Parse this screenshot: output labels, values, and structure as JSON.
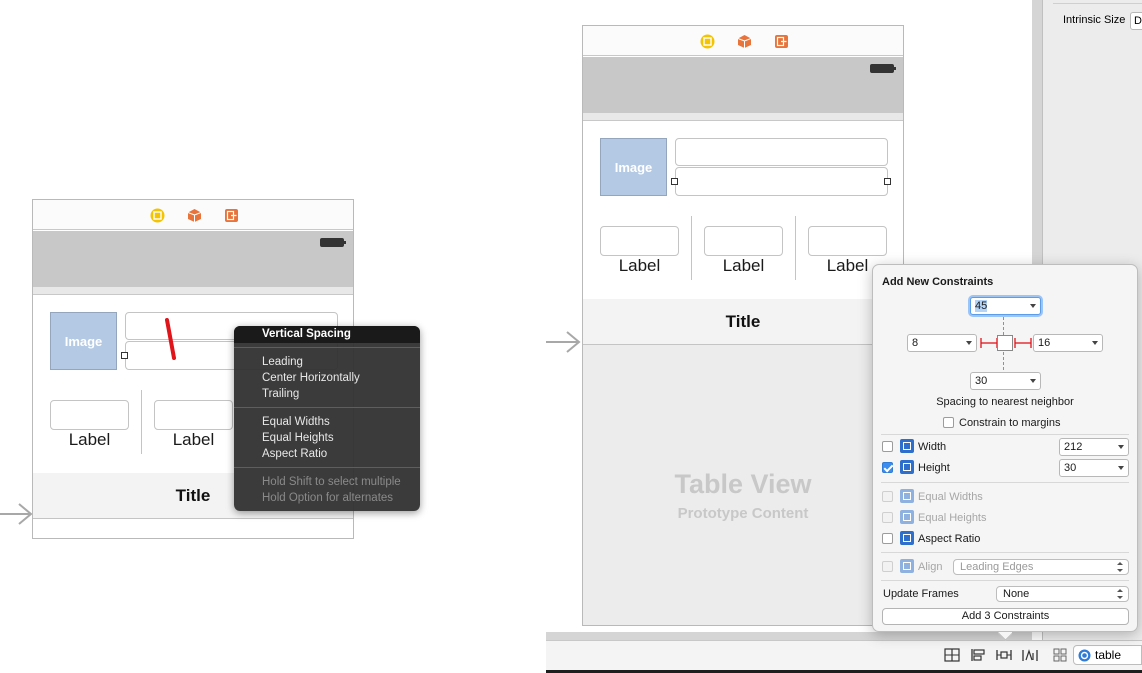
{
  "left_scene": {
    "image_label": "Image",
    "labels": [
      "Label",
      "Label"
    ],
    "title": "Title"
  },
  "context_menu": {
    "items": [
      {
        "label": "Vertical Spacing",
        "highlighted": true
      },
      {
        "label": "Leading"
      },
      {
        "label": "Center Horizontally"
      },
      {
        "label": "Trailing"
      },
      {
        "label": "Equal Widths"
      },
      {
        "label": "Equal Heights"
      },
      {
        "label": "Aspect Ratio"
      }
    ],
    "hints": [
      "Hold Shift to select multiple",
      "Hold Option for alternates"
    ]
  },
  "right_scene": {
    "image_label": "Image",
    "labels": [
      "Label",
      "Label",
      "Label"
    ],
    "title": "Title",
    "table_view_title": "Table View",
    "table_view_subtitle": "Prototype Content"
  },
  "inspector": {
    "intrinsic_size_label": "Intrinsic Size",
    "intrinsic_size_value": "D"
  },
  "constraints_popover": {
    "heading": "Add New Constraints",
    "top_spacing": "45",
    "left_spacing": "8",
    "right_spacing": "16",
    "bottom_spacing": "30",
    "spacing_caption": "Spacing to nearest neighbor",
    "constrain_to_margins": "Constrain to margins",
    "width_label": "Width",
    "width_value": "212",
    "height_label": "Height",
    "height_value": "30",
    "equal_widths": "Equal Widths",
    "equal_heights": "Equal Heights",
    "aspect_ratio": "Aspect Ratio",
    "align_label": "Align",
    "align_value": "Leading Edges",
    "update_frames_label": "Update Frames",
    "update_frames_value": "None",
    "add_button": "Add 3 Constraints"
  },
  "bottom_bar": {
    "filter_value": "table"
  },
  "colors": {
    "accent": "#3b8ef0",
    "image_placeholder": "#b4c9e4",
    "dock_yellow": "#f5c400",
    "dock_orange": "#e8743b",
    "drag_line": "#e0141b"
  }
}
